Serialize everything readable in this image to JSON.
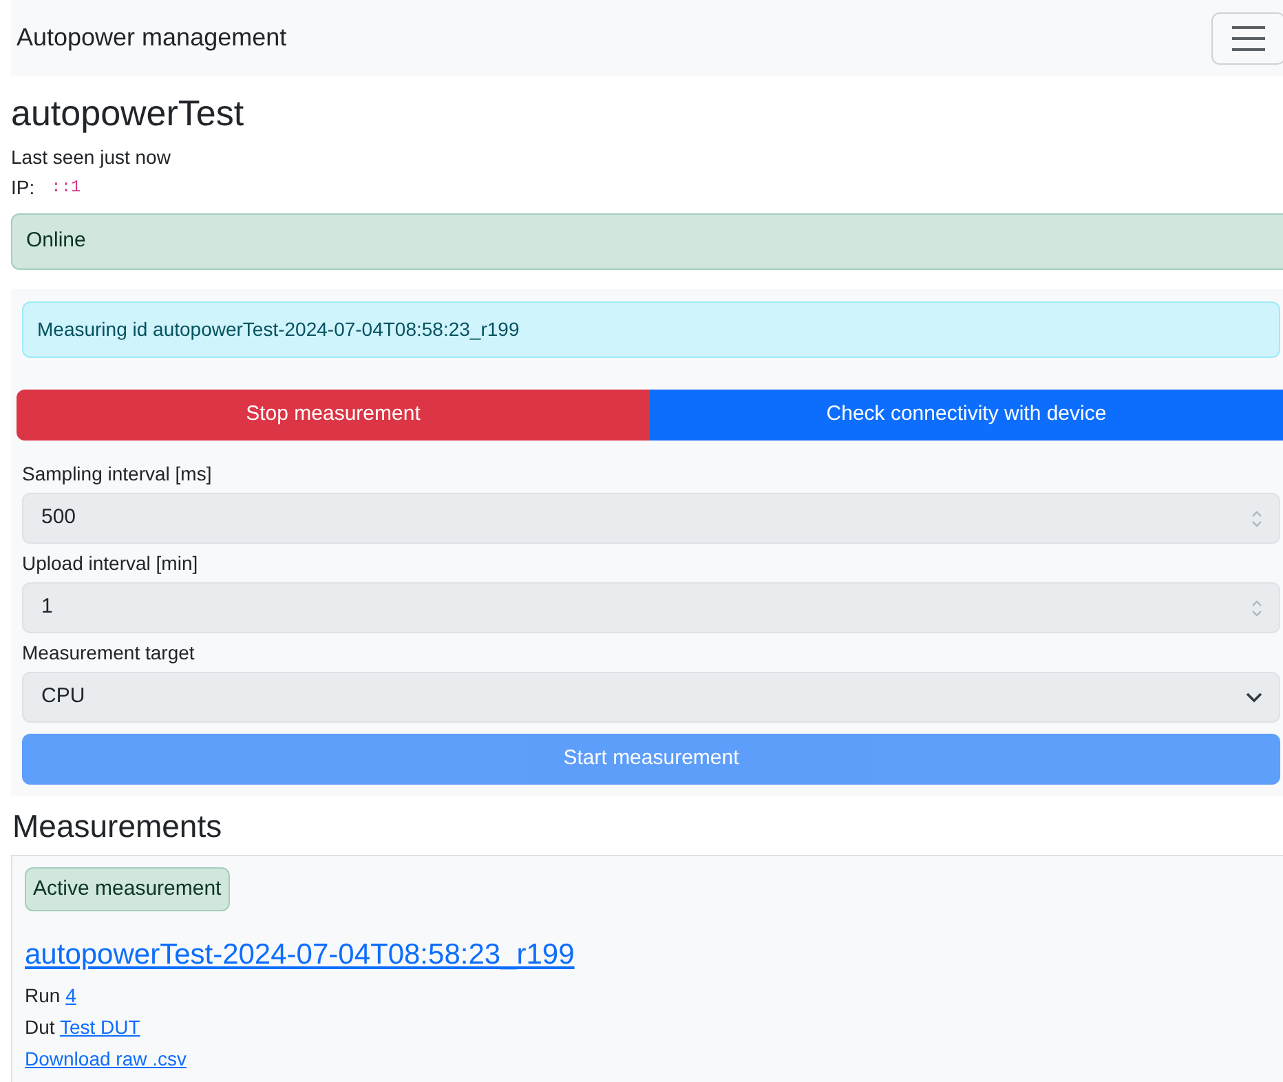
{
  "navbar": {
    "brand": "Autopower management"
  },
  "device": {
    "name": "autopowerTest",
    "last_seen": "Last seen just now",
    "ip_label": "IP:",
    "ip": "::1"
  },
  "status_alert": {
    "kind": "success",
    "text": "Online"
  },
  "control_panel": {
    "info_alert": {
      "kind": "info",
      "text": "Measuring id autopowerTest-2024-07-04T08:58:23_r199"
    },
    "actions": [
      {
        "kind": "danger",
        "label": "Stop measurement"
      },
      {
        "kind": "primary",
        "label": "Check connectivity with device"
      }
    ],
    "fields": [
      {
        "kind": "number",
        "label": "Sampling interval [ms]",
        "value": "500"
      },
      {
        "kind": "number",
        "label": "Upload interval [min]",
        "value": "1"
      },
      {
        "kind": "select",
        "label": "Measurement target",
        "value": "CPU"
      }
    ],
    "start_button": {
      "label": "Start measurement",
      "disabled": true
    }
  },
  "measurements": {
    "heading": "Measurements",
    "items": [
      {
        "badge": "Active measurement",
        "id": "autopowerTest-2024-07-04T08:58:23_r199",
        "run_label": "Run",
        "run": "4",
        "dut_label": "Dut",
        "dut": "Test DUT",
        "download": "Download raw .csv"
      }
    ]
  }
}
